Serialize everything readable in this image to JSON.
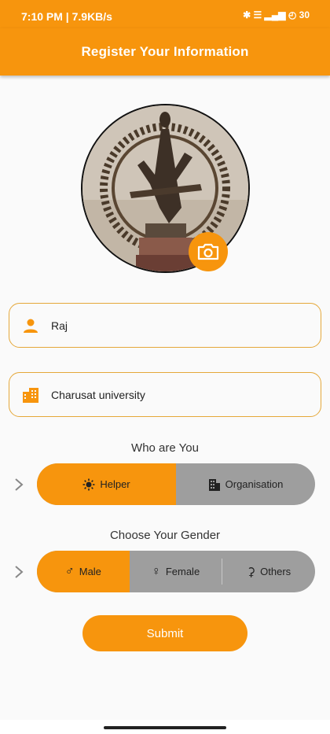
{
  "status_bar": {
    "time_speed": "7:10 PM | 7.9KB/s",
    "icons": "✱ ☰ ▂▄▆ ◴ 30"
  },
  "app_bar": {
    "title": "Register Your Information"
  },
  "profile": {
    "camera_icon": "camera-icon"
  },
  "form": {
    "name": {
      "value": "Raj",
      "icon": "person-icon"
    },
    "organisation": {
      "value": "Charusat university",
      "icon": "building-icon"
    }
  },
  "role": {
    "label": "Who are You",
    "options": [
      {
        "label": "Helper",
        "icon": "sun-icon",
        "selected": true
      },
      {
        "label": "Organisation",
        "icon": "office-building-icon",
        "selected": false
      }
    ]
  },
  "gender": {
    "label": "Choose Your Gender",
    "options": [
      {
        "label": "Male",
        "icon": "male-icon",
        "selected": true
      },
      {
        "label": "Female",
        "icon": "female-icon",
        "selected": false
      },
      {
        "label": "Others",
        "icon": "transgender-icon",
        "selected": false
      }
    ]
  },
  "submit_label": "Submit",
  "colors": {
    "accent": "#f7950d",
    "inactive": "#9e9e9e",
    "field_border": "#e5a83a"
  }
}
